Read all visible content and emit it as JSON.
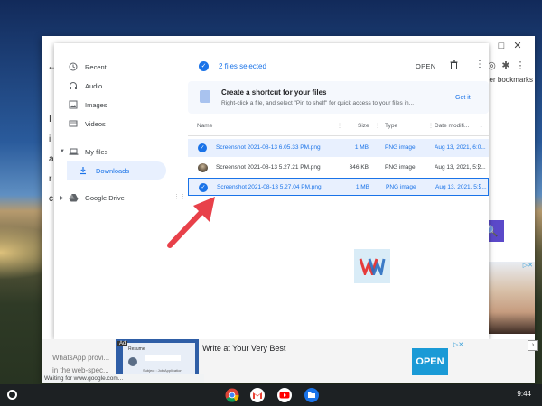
{
  "browser": {
    "bookmarks_label": "her bookmarks",
    "left_letters": [
      "←",
      "I",
      "i",
      "a",
      "r",
      "c"
    ]
  },
  "files_app": {
    "sidebar": {
      "items": [
        {
          "label": "Recent",
          "icon": "clock-icon"
        },
        {
          "label": "Audio",
          "icon": "headphones-icon"
        },
        {
          "label": "Images",
          "icon": "image-icon"
        },
        {
          "label": "Videos",
          "icon": "video-icon"
        },
        {
          "label": "My files",
          "icon": "laptop-icon"
        },
        {
          "label": "Downloads",
          "icon": "download-icon"
        },
        {
          "label": "Google Drive",
          "icon": "drive-icon"
        }
      ]
    },
    "toolbar": {
      "selection_label": "2 files selected",
      "open_label": "OPEN"
    },
    "banner": {
      "title": "Create a shortcut for your files",
      "text": "Right-click a file, and select \"Pin to shelf\" for quick access to your files in...",
      "action": "Got it"
    },
    "columns": {
      "name": "Name",
      "size": "Size",
      "type": "Type",
      "date": "Date modifi..."
    },
    "rows": [
      {
        "name": "Screenshot 2021-08-13 6.05.33 PM.png",
        "size": "1 MB",
        "type": "PNG image",
        "date": "Aug 13, 2021, 6:0..."
      },
      {
        "name": "Screenshot 2021-08-13 5.27.21 PM.png",
        "size": "346 KB",
        "type": "PNG image",
        "date": "Aug 13, 2021, 5:2..."
      },
      {
        "name": "Screenshot 2021-08-13 5.27.04 PM.png",
        "size": "1 MB",
        "type": "PNG image",
        "date": "Aug 13, 2021, 5:2..."
      }
    ]
  },
  "ad": {
    "tag": "Ad",
    "resume_label": "Resume",
    "resume_subject": "Subject : Job Application",
    "title": "Write at Your Very Best",
    "open_label": "OPEN"
  },
  "page": {
    "whatsapp_text": "WhatsApp provi...",
    "whatsapp_text2": "in the web-spec...",
    "status": "Waiting for www.google.com..."
  },
  "shelf": {
    "time": "9:44",
    "apps": [
      "chrome-icon",
      "gmail-icon",
      "youtube-icon",
      "files-icon"
    ]
  },
  "colors": {
    "accent": "#1a73e8",
    "selected_row": "#e8f0fe",
    "arrow": "#e8414a"
  }
}
